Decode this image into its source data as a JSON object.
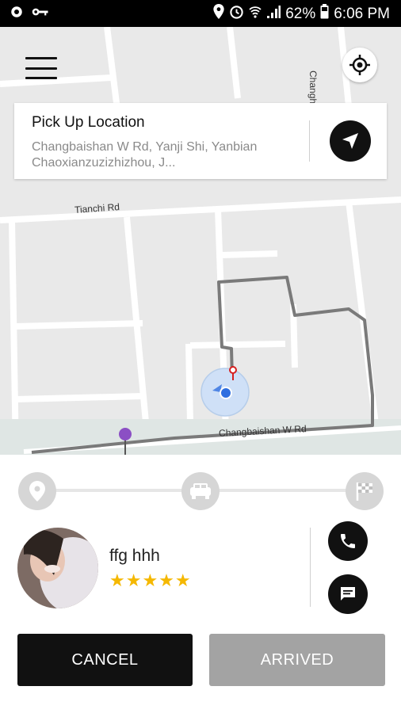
{
  "status_bar": {
    "icons_left": [
      "settings-icon",
      "key-icon"
    ],
    "icons_right": [
      "location-icon",
      "alarm-icon",
      "wifi-icon",
      "signal-icon",
      "battery-icon"
    ],
    "battery": "62%",
    "time": "6:06 PM"
  },
  "map": {
    "streets": {
      "tianchi": "Tianchi Rd",
      "changbaishan": "Changbaishan W Rd",
      "changhe": "Changhe S"
    }
  },
  "pickup": {
    "title": "Pick Up Location",
    "address": "Changbaishan W Rd, Yanji Shi, Yanbian Chaoxianzuzizhizhou, J..."
  },
  "progress": {
    "steps": [
      "pin-icon",
      "car-icon",
      "checkered-flag-icon"
    ]
  },
  "driver": {
    "name": "ffg hhh",
    "rating": 5,
    "stars": "★★★★★"
  },
  "actions": {
    "cancel": "CANCEL",
    "arrived": "ARRIVED"
  },
  "colors": {
    "primary": "#111111",
    "disabled": "#a3a3a3",
    "star": "#f5b800",
    "route": "#777777",
    "user_dot": "#2f6fe0",
    "destination_pin": "#8b4fc4"
  }
}
